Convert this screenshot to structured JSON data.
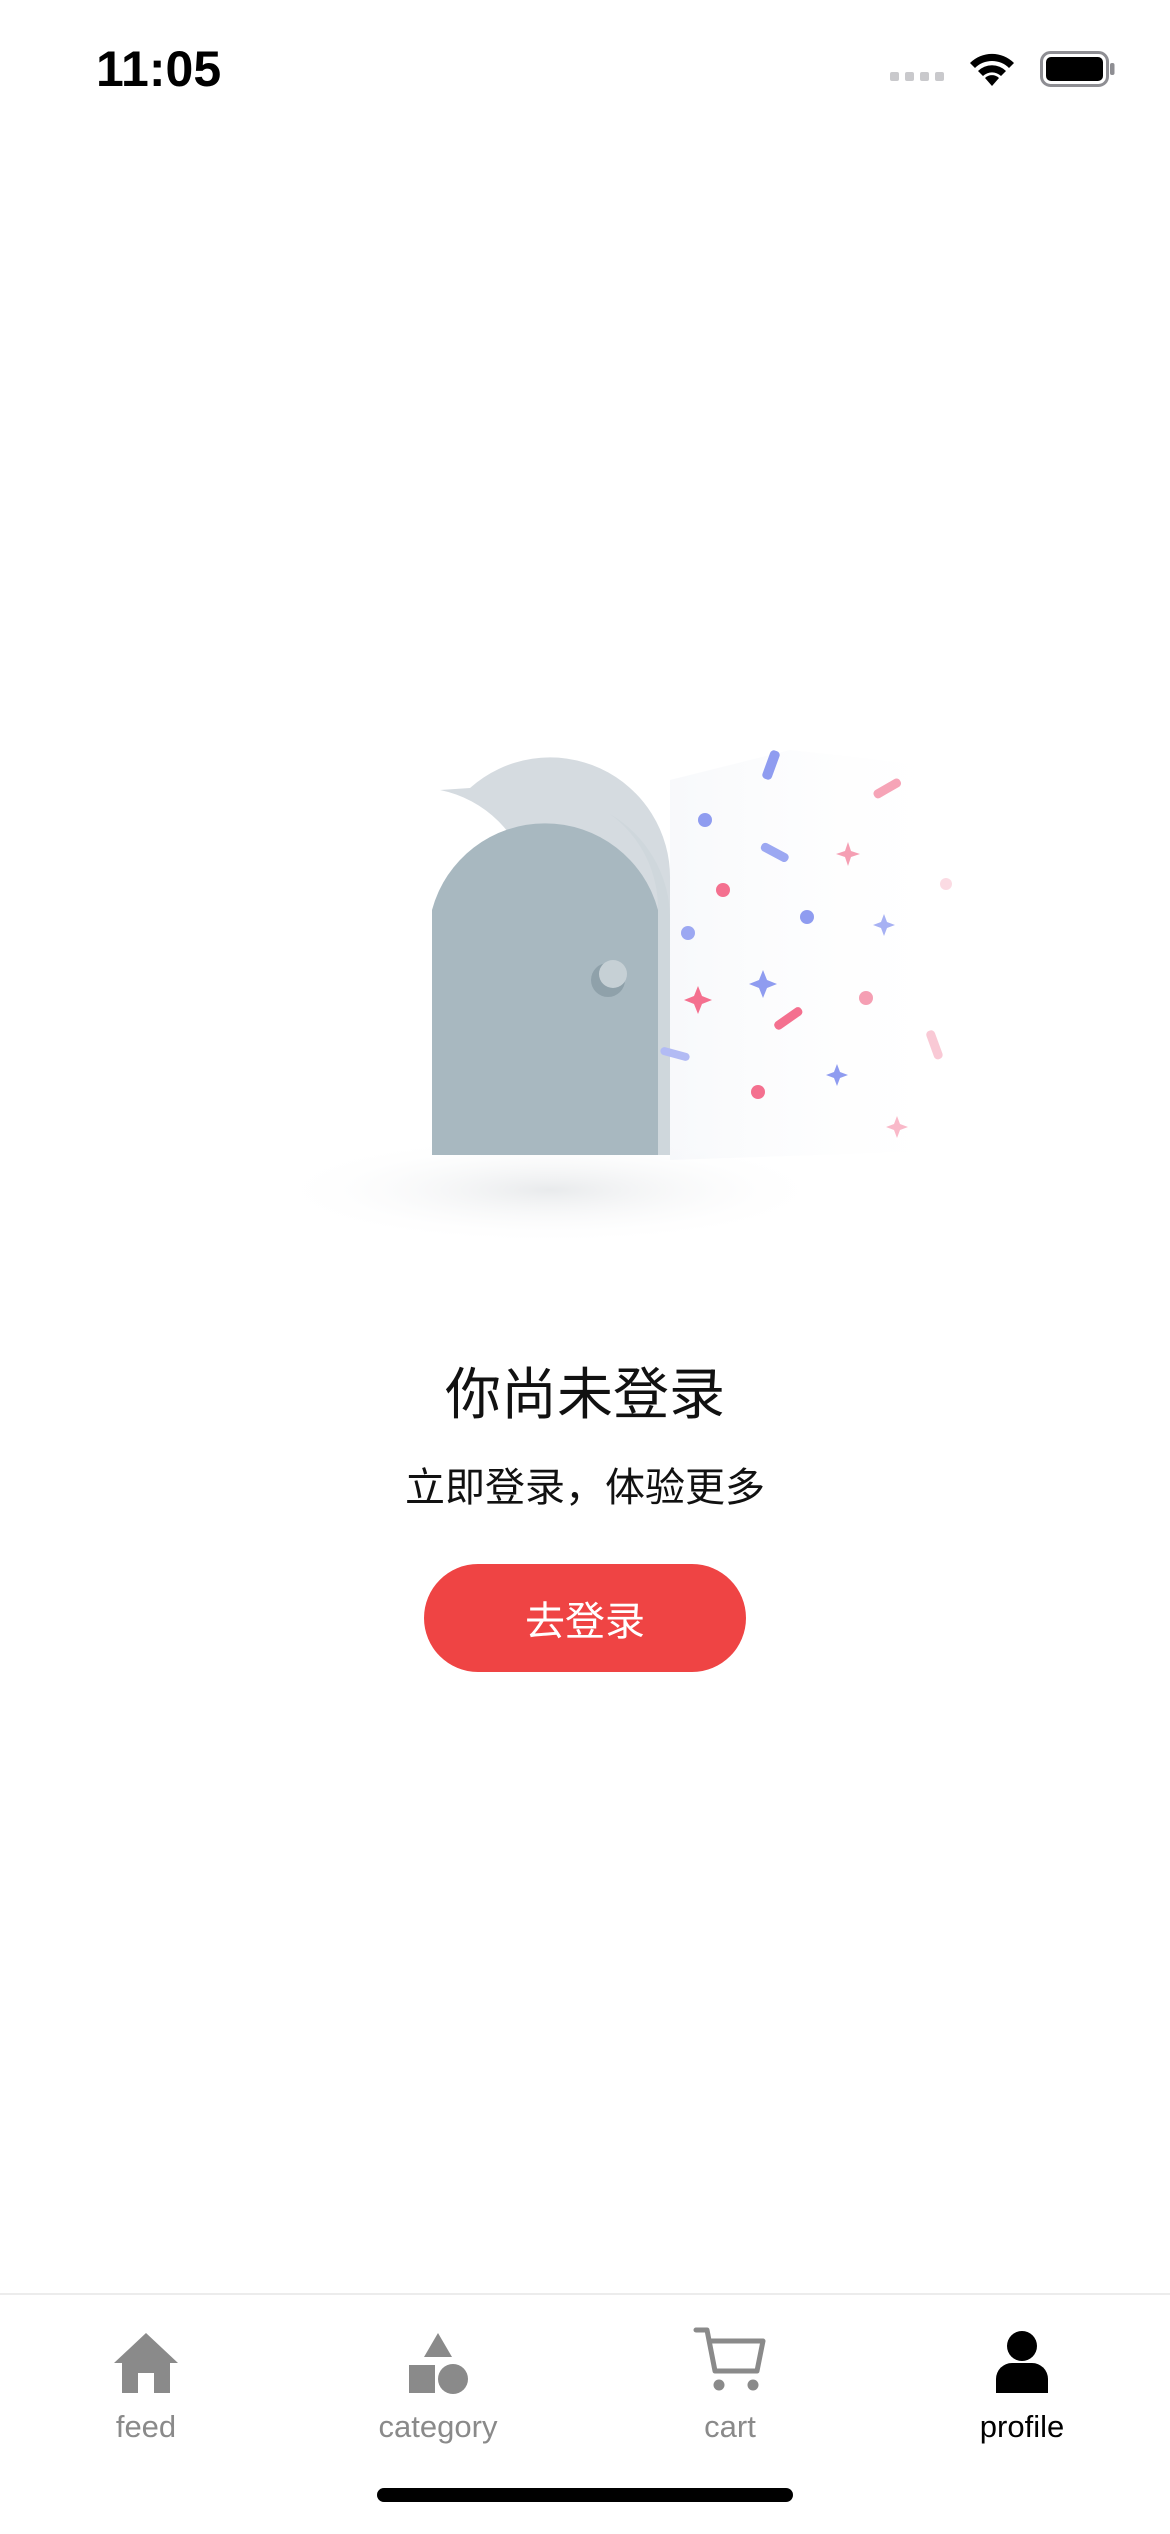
{
  "status_bar": {
    "time": "11:05",
    "icons": [
      "cellular-signal-icon",
      "wifi-icon",
      "battery-icon"
    ]
  },
  "empty_state": {
    "illustration": "door-confetti-illustration",
    "title": "你尚未登录",
    "subtitle": "立即登录，体验更多",
    "button_label": "去登录",
    "button_color": "#ef4444"
  },
  "tab_bar": {
    "active": "profile",
    "items": [
      {
        "label": "feed",
        "icon": "home-icon"
      },
      {
        "label": "category",
        "icon": "category-shapes-icon"
      },
      {
        "label": "cart",
        "icon": "cart-icon"
      },
      {
        "label": "profile",
        "icon": "person-icon"
      }
    ],
    "inactive_color": "#8a8a8a",
    "active_color": "#000000"
  }
}
